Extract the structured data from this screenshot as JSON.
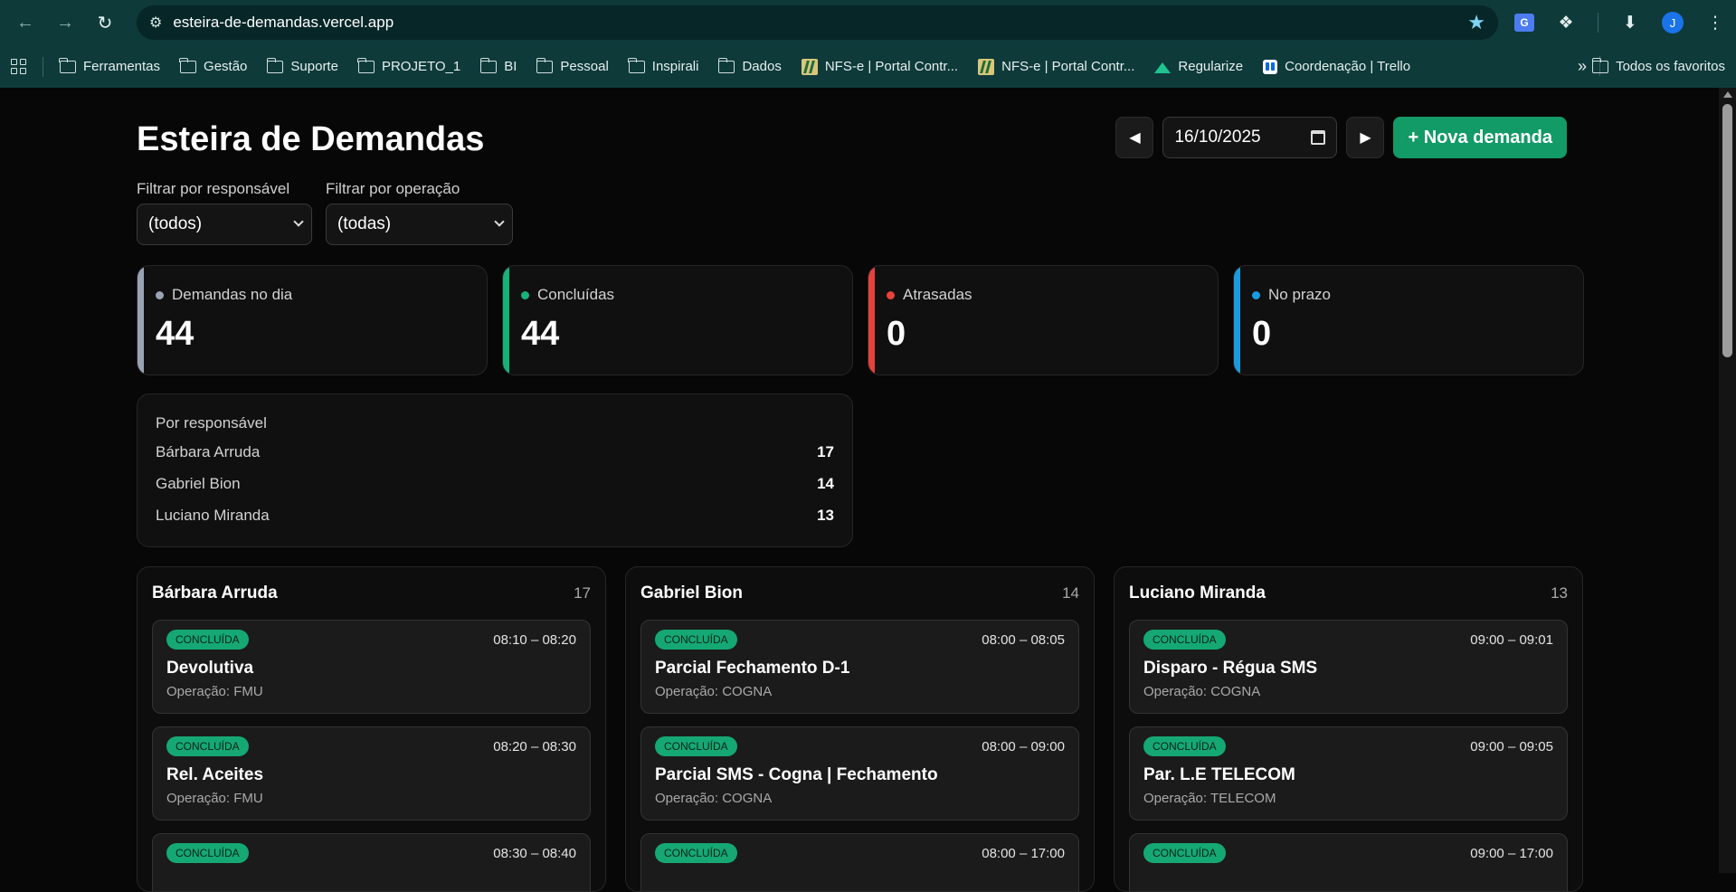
{
  "browser": {
    "url": "esteira-de-demandas.vercel.app",
    "profile_initial": "J",
    "bookmarks": [
      {
        "label": "Ferramentas",
        "icon": "folder-icon"
      },
      {
        "label": "Gestão",
        "icon": "folder-icon"
      },
      {
        "label": "Suporte",
        "icon": "folder-icon"
      },
      {
        "label": "PROJETO_1",
        "icon": "folder-icon"
      },
      {
        "label": "BI",
        "icon": "folder-icon"
      },
      {
        "label": "Pessoal",
        "icon": "folder-icon"
      },
      {
        "label": "Inspirali",
        "icon": "folder-icon"
      },
      {
        "label": "Dados",
        "icon": "folder-icon"
      },
      {
        "label": "NFS-e | Portal Contr...",
        "icon": "nfse-icon"
      },
      {
        "label": "NFS-e | Portal Contr...",
        "icon": "nfse-icon"
      },
      {
        "label": "Regularize",
        "icon": "regularize-icon"
      },
      {
        "label": "Coordenação | Trello",
        "icon": "trello-icon"
      }
    ],
    "all_bookmarks": "Todos os favoritos"
  },
  "header": {
    "title": "Esteira de Demandas",
    "date": "16/10/2025",
    "new_button": "+ Nova demanda"
  },
  "filters": {
    "responsavel_label": "Filtrar por responsável",
    "responsavel_value": "(todos)",
    "operacao_label": "Filtrar por operação",
    "operacao_value": "(todas)"
  },
  "stats": [
    {
      "label": "Demandas no dia",
      "value": "44",
      "color": "#9aa3b5"
    },
    {
      "label": "Concluídas",
      "value": "44",
      "color": "#16b27a"
    },
    {
      "label": "Atrasadas",
      "value": "0",
      "color": "#e5423b"
    },
    {
      "label": "No prazo",
      "value": "0",
      "color": "#1a9be0"
    }
  ],
  "por_responsavel": {
    "title": "Por responsável",
    "rows": [
      {
        "name": "Bárbara Arruda",
        "count": "17"
      },
      {
        "name": "Gabriel Bion",
        "count": "14"
      },
      {
        "name": "Luciano Miranda",
        "count": "13"
      }
    ]
  },
  "columns": [
    {
      "name": "Bárbara Arruda",
      "count": "17",
      "cards": [
        {
          "status": "CONCLUÍDA",
          "time": "08:10 – 08:20",
          "title": "Devolutiva",
          "op": "Operação: FMU"
        },
        {
          "status": "CONCLUÍDA",
          "time": "08:20 – 08:30",
          "title": "Rel. Aceites",
          "op": "Operação: FMU"
        },
        {
          "status": "CONCLUÍDA",
          "time": "08:30 – 08:40",
          "title": "",
          "op": ""
        }
      ]
    },
    {
      "name": "Gabriel Bion",
      "count": "14",
      "cards": [
        {
          "status": "CONCLUÍDA",
          "time": "08:00 – 08:05",
          "title": "Parcial Fechamento D-1",
          "op": "Operação: COGNA"
        },
        {
          "status": "CONCLUÍDA",
          "time": "08:00 – 09:00",
          "title": "Parcial SMS - Cogna | Fechamento",
          "op": "Operação: COGNA"
        },
        {
          "status": "CONCLUÍDA",
          "time": "08:00 – 17:00",
          "title": "",
          "op": ""
        }
      ]
    },
    {
      "name": "Luciano Miranda",
      "count": "13",
      "cards": [
        {
          "status": "CONCLUÍDA",
          "time": "09:00 – 09:01",
          "title": "Disparo - Régua SMS",
          "op": "Operação: COGNA"
        },
        {
          "status": "CONCLUÍDA",
          "time": "09:00 – 09:05",
          "title": "Par. L.E TELECOM",
          "op": "Operação: TELECOM"
        },
        {
          "status": "CONCLUÍDA",
          "time": "09:00 – 17:00",
          "title": "",
          "op": ""
        }
      ]
    }
  ]
}
